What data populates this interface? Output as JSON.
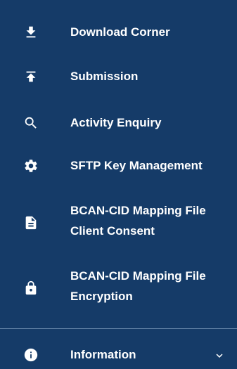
{
  "sidebar": {
    "items": [
      {
        "label": "Download Corner",
        "icon": "download-icon"
      },
      {
        "label": "Submission",
        "icon": "upload-icon"
      },
      {
        "label": "Activity Enquiry",
        "icon": "search-icon"
      },
      {
        "label": "SFTP Key Management",
        "icon": "gear-icon"
      },
      {
        "label_lines": [
          "BCAN-CID Mapping File",
          "Client Consent"
        ],
        "icon": "file-document-icon"
      },
      {
        "label_lines": [
          "BCAN-CID Mapping File",
          "Encryption"
        ],
        "icon": "lock-icon"
      }
    ],
    "information": {
      "label": "Information",
      "icon": "info-icon",
      "expand_icon": "chevron-down-icon"
    }
  },
  "colors": {
    "background": "#153b68",
    "text": "#ffffff",
    "divider": "#5f7fa3"
  }
}
